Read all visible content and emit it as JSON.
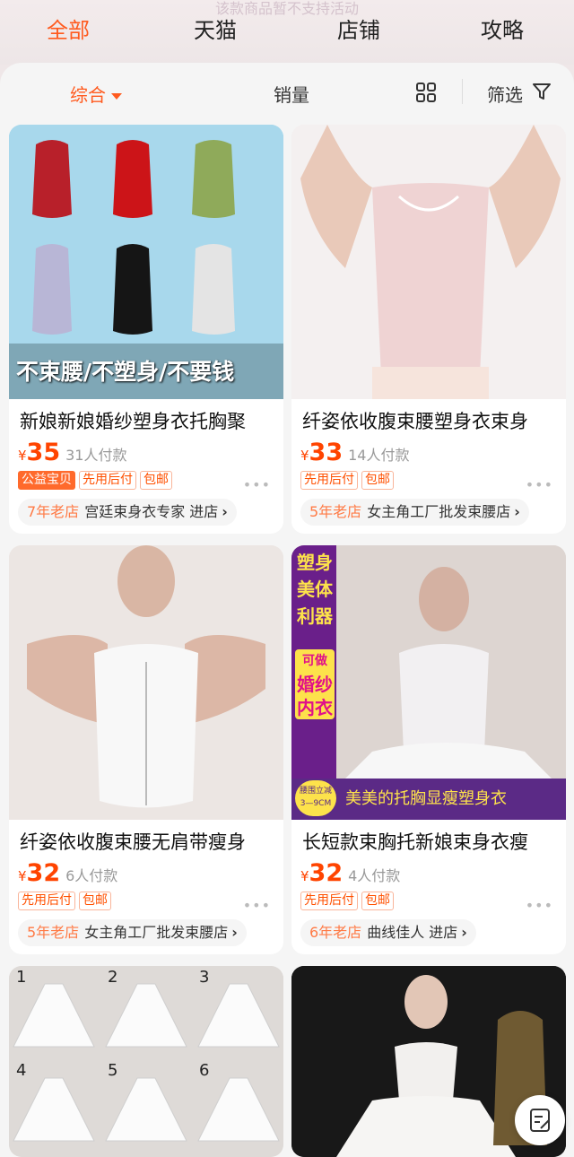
{
  "header": {
    "ghost_text": "该款商品暂不支持活动",
    "tabs": [
      "全部",
      "天猫",
      "店铺",
      "攻略"
    ]
  },
  "sortbar": {
    "comprehensive": "综合",
    "sales": "销量",
    "filter": "筛选"
  },
  "colors": {
    "accent": "#ff5a1e",
    "price": "#ff4400"
  },
  "products": [
    {
      "title": "新娘新娘婚纱塑身衣托胸聚",
      "price": "35",
      "sold": "31人付款",
      "tags": [
        "公益宝贝",
        "先用后付",
        "包邮"
      ],
      "shop_age": "7年老店",
      "shop_name": "宫廷束身衣专家 进店",
      "image_caption": "不束腰/不塑身/不要钱"
    },
    {
      "title": "纤姿依收腹束腰塑身衣束身",
      "price": "33",
      "sold": "14人付款",
      "tags": [
        "先用后付",
        "包邮"
      ],
      "shop_age": "5年老店",
      "shop_name": "女主角工厂批发束腰店"
    },
    {
      "title": "纤姿依收腹束腰无肩带瘦身",
      "price": "32",
      "sold": "6人付款",
      "tags": [
        "先用后付",
        "包邮"
      ],
      "shop_age": "5年老店",
      "shop_name": "女主角工厂批发束腰店"
    },
    {
      "title": "长短款束胸托新娘束身衣瘦",
      "price": "32",
      "sold": "4人付款",
      "tags": [
        "先用后付",
        "包邮"
      ],
      "shop_age": "6年老店",
      "shop_name": "曲线佳人 进店",
      "image_side_text": [
        "塑身",
        "美体",
        "利器",
        "可做",
        "婚纱",
        "内衣"
      ],
      "image_badge": [
        "腰围立减",
        "3—9CM"
      ],
      "image_banner": "美美的托胸显瘦塑身衣"
    }
  ],
  "petticoat_numbers": [
    "1",
    "2",
    "3",
    "4",
    "5",
    "6"
  ]
}
